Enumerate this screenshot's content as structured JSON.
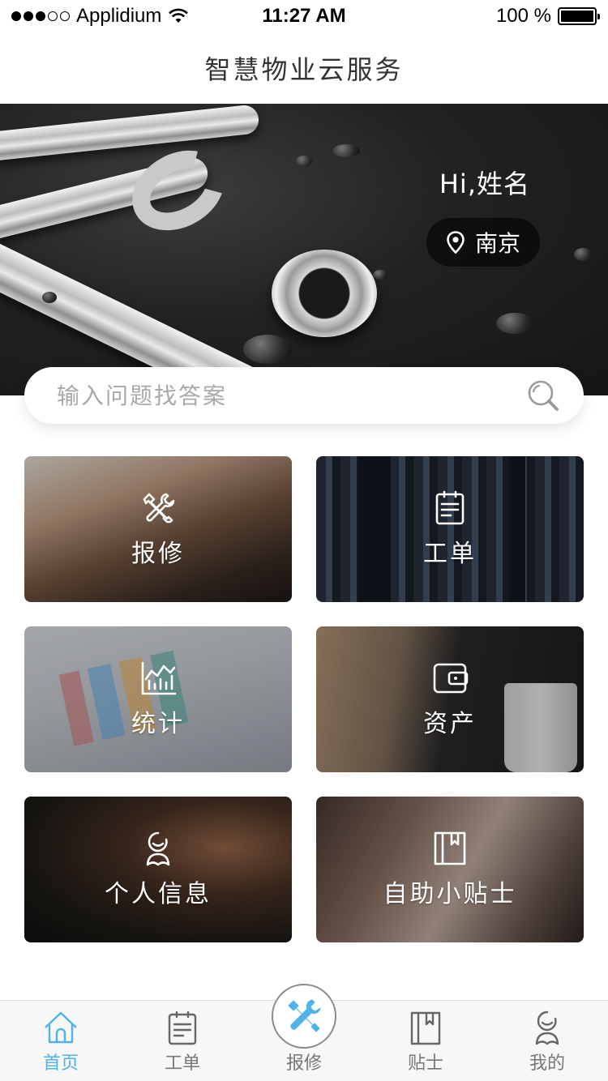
{
  "status_bar": {
    "carrier": "Applidium",
    "time": "11:27 AM",
    "battery_text": "100 %",
    "battery_level_percent": 100,
    "signal_bars_filled": 3,
    "signal_bars_total": 5
  },
  "header": {
    "title": "智慧物业云服务"
  },
  "hero": {
    "greeting": "Hi,姓名",
    "location": "南京",
    "location_icon": "location-pin-icon"
  },
  "search": {
    "placeholder": "输入问题找答案",
    "icon": "search-icon"
  },
  "grid": [
    {
      "label": "报修",
      "icon": "repair-tools-icon"
    },
    {
      "label": "工单",
      "icon": "clipboard-icon"
    },
    {
      "label": "统计",
      "icon": "chart-icon"
    },
    {
      "label": "资产",
      "icon": "wallet-icon"
    },
    {
      "label": "个人信息",
      "icon": "person-icon"
    },
    {
      "label": "自助小贴士",
      "icon": "bookmark-icon"
    }
  ],
  "tabbar": {
    "items": [
      {
        "label": "首页",
        "icon": "home-icon",
        "active": true
      },
      {
        "label": "工单",
        "icon": "clipboard-icon",
        "active": false
      },
      {
        "label": "报修",
        "icon": "repair-tools-icon",
        "active": false
      },
      {
        "label": "贴士",
        "icon": "bookmark-icon",
        "active": false
      },
      {
        "label": "我的",
        "icon": "person-icon",
        "active": false
      }
    ]
  },
  "colors": {
    "accent": "#4fb3ea",
    "text_primary": "#333333",
    "text_muted": "#777777",
    "tabbar_bg": "#f7f7f7"
  }
}
